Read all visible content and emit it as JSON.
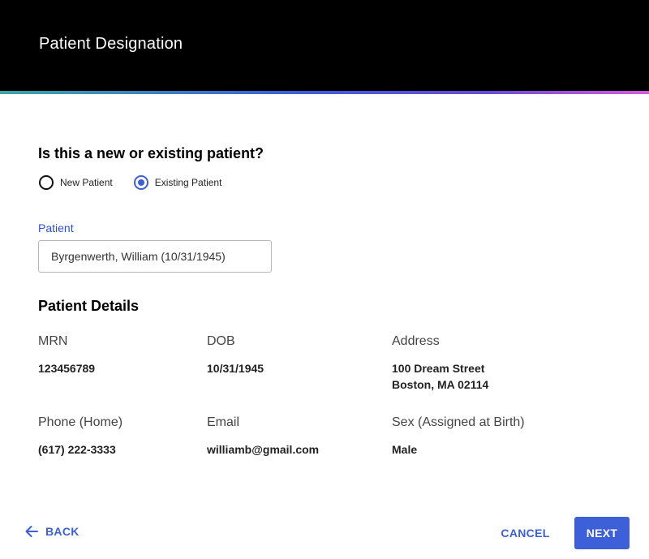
{
  "header": {
    "title": "Patient Designation"
  },
  "question": {
    "text": "Is this a new or existing patient?",
    "options": [
      {
        "label": "New Patient",
        "selected": false
      },
      {
        "label": "Existing Patient",
        "selected": true
      }
    ]
  },
  "patient_field": {
    "label": "Patient",
    "value": "Byrgenwerth, William (10/31/1945)"
  },
  "details": {
    "title": "Patient Details",
    "mrn": {
      "label": "MRN",
      "value": "123456789"
    },
    "dob": {
      "label": "DOB",
      "value": "10/31/1945"
    },
    "address": {
      "label": "Address",
      "line1": "100 Dream Street",
      "line2": "Boston, MA 02114"
    },
    "phone": {
      "label": "Phone (Home)",
      "value": "(617) 222-3333"
    },
    "email": {
      "label": "Email",
      "value": "williamb@gmail.com"
    },
    "sex": {
      "label": "Sex (Assigned at Birth)",
      "value": "Male"
    }
  },
  "footer": {
    "back_label": "BACK",
    "back_icon": "arrow-left-icon",
    "cancel_label": "CANCEL",
    "next_label": "NEXT"
  },
  "colors": {
    "header_bg": "#000000",
    "accent": "#3d5fd8",
    "field_label": "#2c4fd1"
  }
}
